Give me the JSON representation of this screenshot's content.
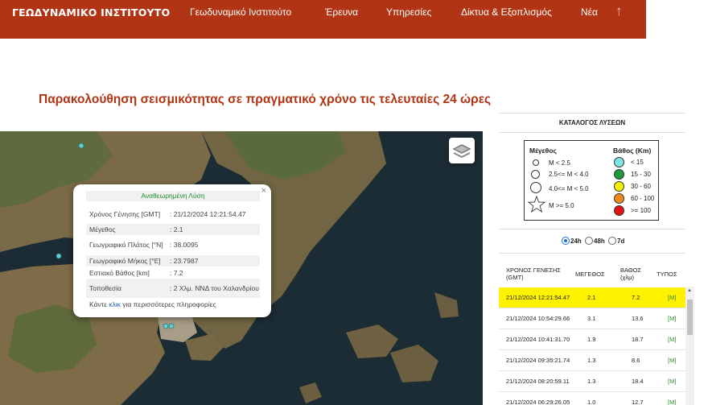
{
  "header": {
    "brand": "ΓΕΩΔΥΝΑΜΙΚΟ ΙΝΣΤΙΤΟΥΤΟ",
    "nav": [
      "Γεωδυναμικό Ινστιτούτο",
      "Έρευνα",
      "Υπηρεσίες",
      "Δίκτυα & Εξοπλισμός",
      "Νέα"
    ],
    "up_icon": "↑"
  },
  "page_title": "Παρακολούθηση σεισμικότητας σε πραγματικό χρόνο τις τελευταίες 24 ώρες",
  "popup": {
    "title": "Αναθεωρημένη Λύση",
    "close": "×",
    "rows": [
      {
        "label": "Χρόνος Γένησης [GMT]",
        "value": ": 21/12/2024 12:21:54.47"
      },
      {
        "label": "Μέγεθος",
        "value": ": 2.1"
      },
      {
        "label": "Γεωγραφικό Πλάτος [°N]",
        "value": ": 38.0095"
      },
      {
        "label": "Γεωγραφικό Μήκος [°E]",
        "value": ": 23.7987"
      },
      {
        "label": "Εστιακό Βάθος [km]",
        "value": ": 7.2"
      },
      {
        "label": "Τοποθεσία",
        "value": ": 2 Χλμ. ΝΝΔ του Χαλανδρίου"
      }
    ],
    "footer_pre": "Κάντε ",
    "footer_link": "κλικ",
    "footer_post": " για περισσότερες πληροφορίες"
  },
  "catalog": {
    "title": "ΚΑΤΑΛΟΓΟΣ ΛΥΣΕΩΝ",
    "legend": {
      "size_heading": "Μέγεθος",
      "sizes": [
        "M < 2.5",
        "2.5<= M < 4.0",
        "4.0<= M < 5.0",
        "M >= 5.0"
      ],
      "depth_heading": "Βάθος (Km)",
      "depths": [
        {
          "label": "< 15",
          "color": "#7fe3e3"
        },
        {
          "label": "15 - 30",
          "color": "#1f9a3a"
        },
        {
          "label": "30 - 60",
          "color": "#f5f000"
        },
        {
          "label": "60 - 100",
          "color": "#f08a1c"
        },
        {
          "label": ">= 100",
          "color": "#e01414"
        }
      ]
    },
    "periods": [
      "24h",
      "48h",
      "7d"
    ],
    "selected_period": "24h",
    "columns": [
      "ΧΡΟΝΟΣ ΓΕΝΕΣΗΣ (GMT)",
      "ΜΕΓΕΘΟΣ",
      "ΒΑΘΟΣ (χλμ)",
      "ΤΥΠΟΣ"
    ],
    "rows": [
      {
        "time": "21/12/2024 12:21:54.47",
        "mag": "2.1",
        "depth": "7.2",
        "type": "[M]",
        "highlight": true
      },
      {
        "time": "21/12/2024 10:54:29.66",
        "mag": "3.1",
        "depth": "13.6",
        "type": "[M]"
      },
      {
        "time": "21/12/2024 10:41:31.70",
        "mag": "1.9",
        "depth": "18.7",
        "type": "[M]"
      },
      {
        "time": "21/12/2024 09:35:21.74",
        "mag": "1.3",
        "depth": "8.6",
        "type": "[M]"
      },
      {
        "time": "21/12/2024 08:20:59.11",
        "mag": "1.3",
        "depth": "18.4",
        "type": "[M]"
      },
      {
        "time": "21/12/2024 06:29:26.05",
        "mag": "1.0",
        "depth": "12.7",
        "type": "[M]"
      }
    ]
  },
  "colors": {
    "header": "#b13514",
    "highlight": "#fff200",
    "quake_dot": "#5fd3d3"
  }
}
